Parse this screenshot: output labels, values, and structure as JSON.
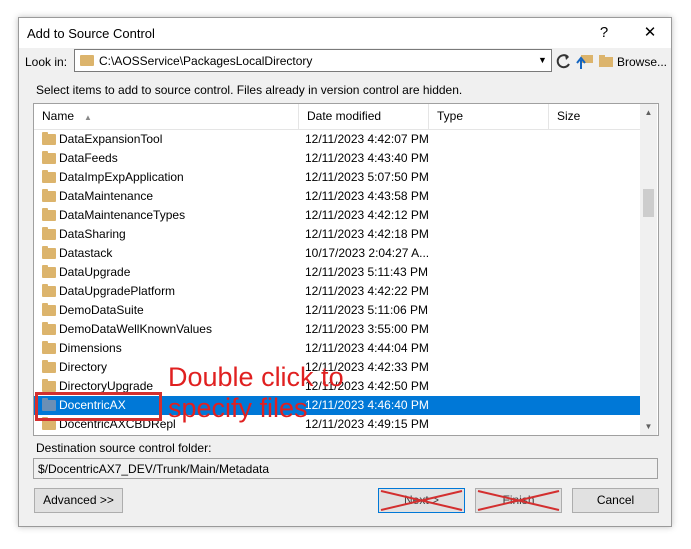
{
  "window": {
    "title": "Add to Source Control",
    "help": "?",
    "close": "✕"
  },
  "lookin": {
    "label": "Look in:",
    "path": "C:\\AOSService\\PackagesLocalDirectory",
    "browse_label": "Browse..."
  },
  "info_text": "Select items to add to source control. Files already in version control are hidden.",
  "columns": {
    "name": "Name",
    "date": "Date modified",
    "type": "Type",
    "size": "Size"
  },
  "rows": [
    {
      "name": "DataExpansionTool",
      "date": "12/11/2023 4:42:07 PM"
    },
    {
      "name": "DataFeeds",
      "date": "12/11/2023 4:43:40 PM"
    },
    {
      "name": "DataImpExpApplication",
      "date": "12/11/2023 5:07:50 PM"
    },
    {
      "name": "DataMaintenance",
      "date": "12/11/2023 4:43:58 PM"
    },
    {
      "name": "DataMaintenanceTypes",
      "date": "12/11/2023 4:42:12 PM"
    },
    {
      "name": "DataSharing",
      "date": "12/11/2023 4:42:18 PM"
    },
    {
      "name": "Datastack",
      "date": "10/17/2023 2:04:27 A..."
    },
    {
      "name": "DataUpgrade",
      "date": "12/11/2023 5:11:43 PM"
    },
    {
      "name": "DataUpgradePlatform",
      "date": "12/11/2023 4:42:22 PM"
    },
    {
      "name": "DemoDataSuite",
      "date": "12/11/2023 5:11:06 PM"
    },
    {
      "name": "DemoDataWellKnownValues",
      "date": "12/11/2023 3:55:00 PM"
    },
    {
      "name": "Dimensions",
      "date": "12/11/2023 4:44:04 PM"
    },
    {
      "name": "Directory",
      "date": "12/11/2023 4:42:33 PM"
    },
    {
      "name": "DirectoryUpgrade",
      "date": "12/11/2023 4:42:50 PM"
    },
    {
      "name": "DocentricAX",
      "date": "12/11/2023 4:46:40 PM",
      "selected": true
    },
    {
      "name": "DocentricAXCBDRepl",
      "date": "12/11/2023 4:49:15 PM"
    }
  ],
  "annotation": {
    "line1": "Double click to",
    "line2": "specify files",
    "color": "#e02020"
  },
  "destination": {
    "label": "Destination source control folder:",
    "value": "$/DocentricAX7_DEV/Trunk/Main/Metadata"
  },
  "buttons": {
    "advanced": "Advanced >>",
    "next": "Next >",
    "finish": "Finish",
    "cancel": "Cancel"
  },
  "colors": {
    "selection": "#0078d7",
    "folder": "#dcb46c",
    "strike": "#d32f2f"
  }
}
